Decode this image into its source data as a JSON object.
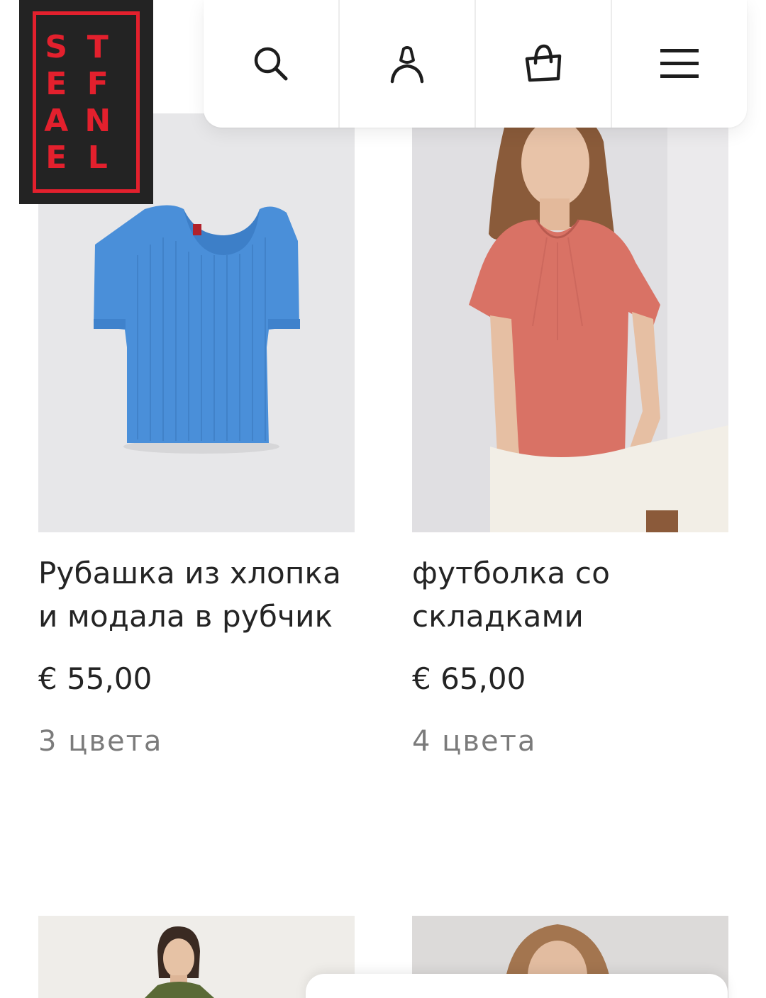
{
  "brand": {
    "letters": [
      "S",
      "T",
      "E",
      "F",
      "A",
      "N",
      "E",
      "L"
    ],
    "colors": {
      "logo_bg": "#232323",
      "logo_red": "#e3202d"
    }
  },
  "nav": {
    "icons": [
      "search-icon",
      "account-icon",
      "shopping-bag-icon",
      "menu-icon"
    ]
  },
  "products": [
    {
      "title": "Рубашка из хлопка и модала в рубчик",
      "price": "€ 55,00",
      "colors": "3 цвета",
      "image": "blue-ribbed-tshirt"
    },
    {
      "title": "футболка со складками",
      "price": "€ 65,00",
      "colors": "4 цвета",
      "image": "model-in-pink-pleated-tshirt"
    },
    {
      "image": "model-in-green-top"
    },
    {
      "image": "model-portrait"
    }
  ]
}
